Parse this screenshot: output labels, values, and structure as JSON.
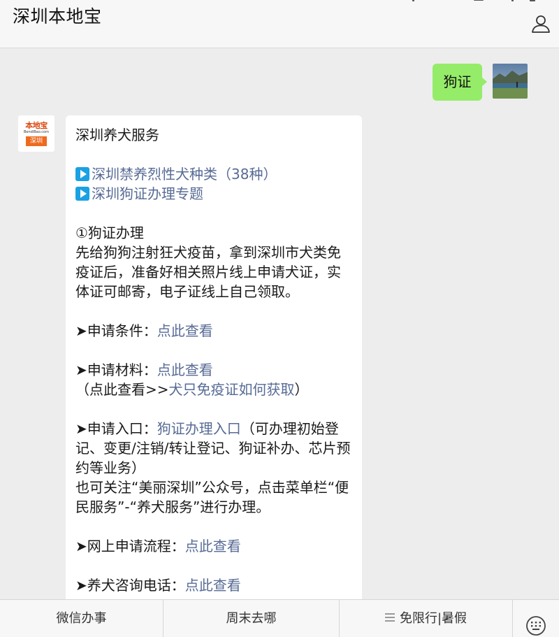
{
  "header": {
    "title": "深圳本地宝",
    "profile_icon": "person-outline-icon"
  },
  "chat": {
    "user_message": {
      "text": "狗证",
      "bubble_color": "#95ec69",
      "avatar": "landscape-photo-avatar"
    },
    "bot_message": {
      "avatar": {
        "top_text": "本地宝",
        "mid_text": "BendiBao.com",
        "badge_text": "深圳"
      },
      "heading": "深圳养犬服务",
      "topic_links": [
        {
          "icon": "play-icon",
          "label": "深圳禁养烈性犬种类（38种）"
        },
        {
          "icon": "play-icon",
          "label": "深圳狗证办理专题"
        }
      ],
      "section_title": "①狗证办理",
      "section_body": "先给狗狗注射狂犬疫苗，拿到深圳市犬类免疫证后，准备好相关照片线上申请犬证，实体证可邮寄，电子证线上自己领取。",
      "arrow": "➤",
      "items": {
        "conditions": {
          "label": "申请条件：",
          "link": "点此查看"
        },
        "materials": {
          "label": "申请材料：",
          "link": "点此查看",
          "note_prefix": "（点此查看>>",
          "note_link": "犬只免疫证如何获取",
          "note_suffix": "）"
        },
        "entrance": {
          "label": "申请入口：",
          "link": "狗证办理入口",
          "desc": "（可办理初始登记、变更/注销/转让登记、狗证补办、芯片预约等业务）",
          "extra": "也可关注“美丽深圳”公众号，点击菜单栏“便民服务”-“养犬服务”进行办理。"
        },
        "process": {
          "label": "网上申请流程：",
          "link": "点此查看"
        },
        "hotline": {
          "label": "养犬咨询电话：",
          "link": "点此查看"
        }
      },
      "link_color": "#576b95"
    }
  },
  "bottom_menu": {
    "items": [
      "微信办事",
      "周末去哪",
      "免限行|暑假"
    ],
    "keyboard_icon": "keyboard-icon",
    "menu_lines_icon": "menu-lines-icon"
  }
}
